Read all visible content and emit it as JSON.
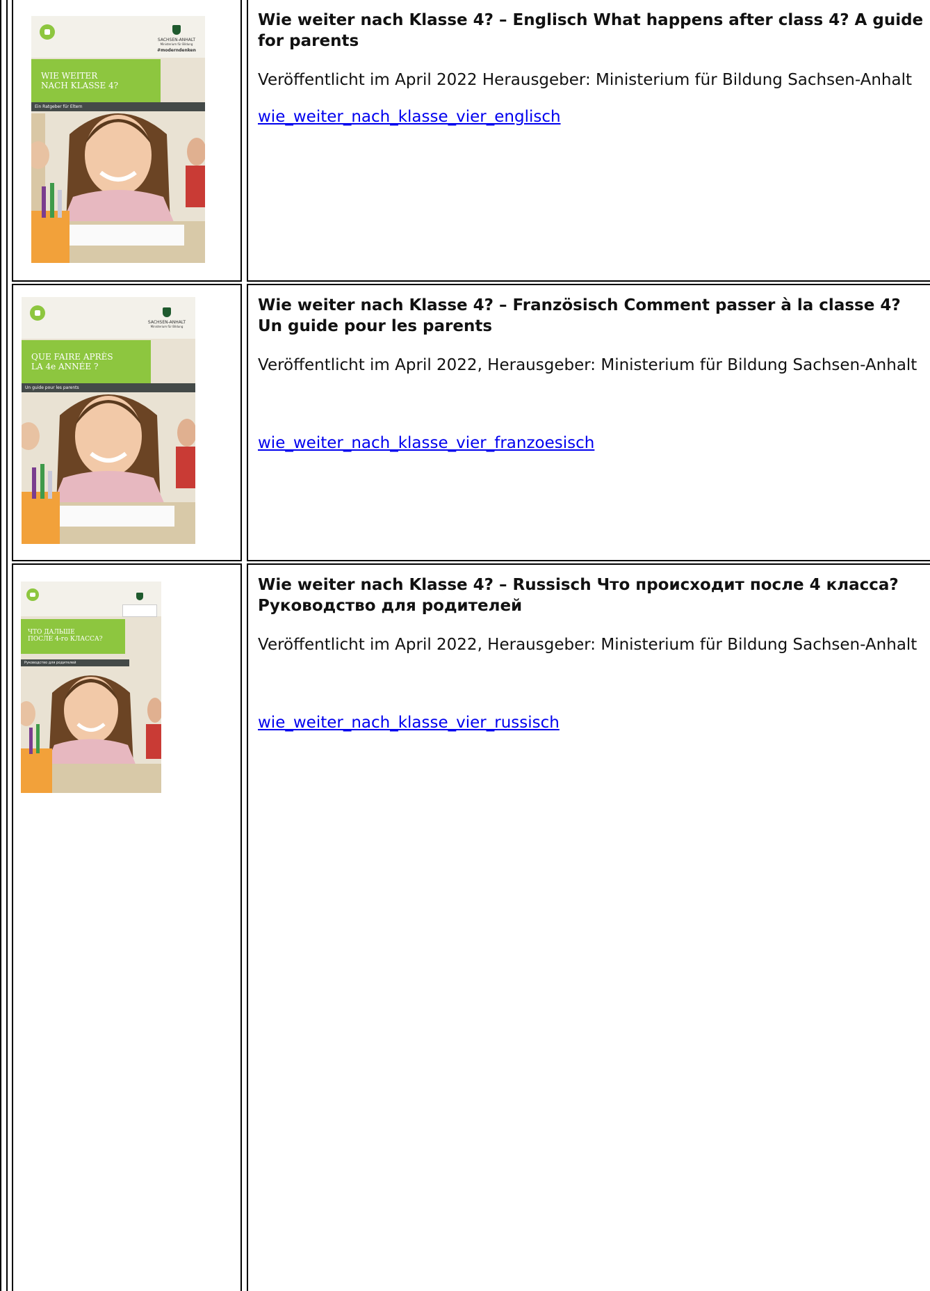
{
  "entries": [
    {
      "title": "Wie weiter nach Klasse 4? – Englisch What happens after class 4? A guide for parents",
      "published": "Veröffentlicht im April 2022 Herausgeber: Ministerium für Bildung Sachsen-Anhalt",
      "link": "wie_weiter_nach_klasse_vier_englisch",
      "cover": {
        "heading_line1": "WIE WEITER",
        "heading_line2": "NACH KLASSE 4?",
        "subtitle": "Ein Ratgeber für Eltern",
        "logo": "SACHSEN-ANHALT",
        "logo_sub": "Ministerium für Bildung",
        "hashtag": "#moderndenken"
      }
    },
    {
      "title": "Wie weiter nach Klasse 4? – Französisch Comment passer à la classe 4? Un guide pour les parents",
      "published": "Veröffentlicht im April 2022, Herausgeber: Ministerium für Bildung Sachsen-Anhalt",
      "link": "wie_weiter_nach_klasse_vier_franzoesisch",
      "cover": {
        "heading_line1": "QUE FAIRE APRÈS",
        "heading_line2": "LA 4e ANNÉE ?",
        "subtitle": "Un guide pour les parents",
        "logo": "SACHSEN-ANHALT",
        "logo_sub": "Ministerium für Bildung"
      }
    },
    {
      "title": "Wie weiter nach Klasse 4? – Russisch Что происходит после 4 класса? Руководство для родителей",
      "published": "Veröffentlicht im April 2022, Herausgeber: Ministerium für Bildung Sachsen-Anhalt",
      "link": "wie_weiter_nach_klasse_vier_russisch",
      "cover": {
        "heading_line1": "ЧТО ДАЛЬШЕ",
        "heading_line2": "ПОСЛЕ 4-го КЛАССА?",
        "subtitle": "Руководство для родителей"
      }
    }
  ]
}
